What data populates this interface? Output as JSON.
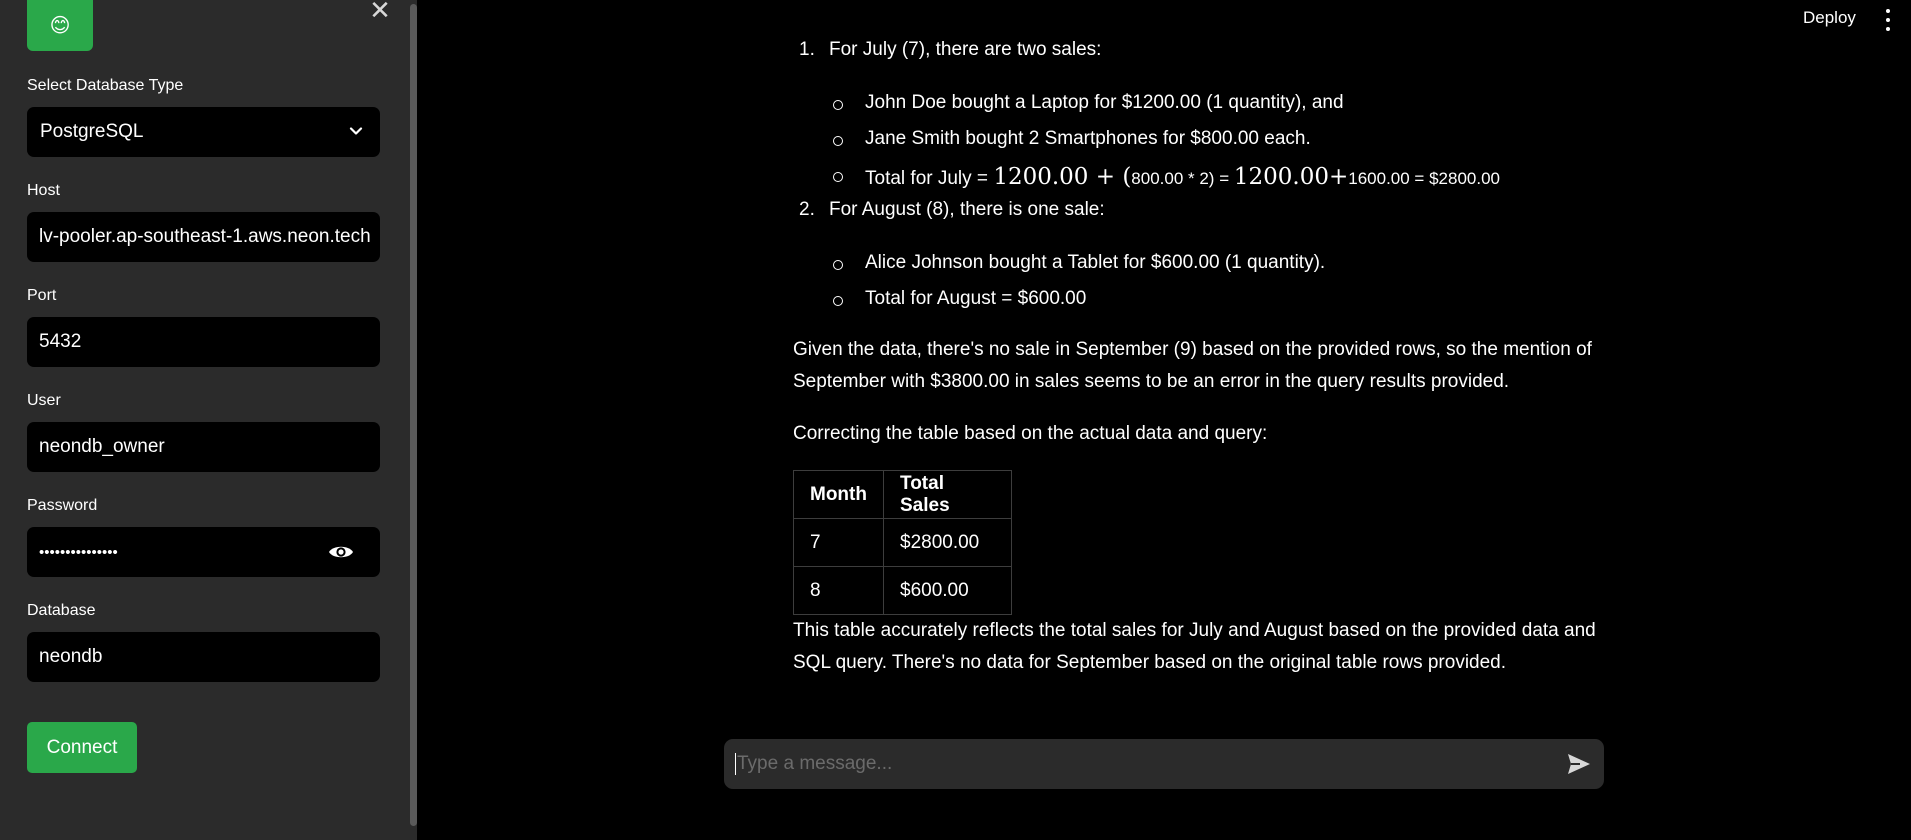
{
  "header": {
    "deploy_label": "Deploy"
  },
  "sidebar": {
    "logo_emoji": "😊",
    "db_type_label": "Select Database Type",
    "db_type_value": "PostgreSQL",
    "host_label": "Host",
    "host_value": "lv-pooler.ap-southeast-1.aws.neon.tech",
    "port_label": "Port",
    "port_value": "5432",
    "user_label": "User",
    "user_value": "neondb_owner",
    "password_label": "Password",
    "password_value": "•••••••••••••••",
    "database_label": "Database",
    "database_value": "neondb",
    "connect_label": "Connect"
  },
  "message": {
    "item1_num": "1.",
    "item1_text": "For July (7), there are two sales:",
    "item1_bullets": [
      "John Doe bought a Laptop for $1200.00 (1 quantity), and",
      "Jane Smith bought 2 Smartphones for $800.00 each."
    ],
    "total_july": {
      "prefix": "Total for July = ",
      "m1": "1200.00 + (",
      "s1": "800.00 * 2) = ",
      "m2": "1200.00+",
      "s2": "1600.00 = $2800.00"
    },
    "item2_num": "2.",
    "item2_text": "For August (8), there is one sale:",
    "item2_bullets": [
      "Alice Johnson bought a Tablet for $600.00 (1 quantity).",
      "Total for August = $600.00"
    ],
    "para1_line1": "Given the data, there's no sale in September (9) based on the provided rows, so the mention of",
    "para1_line2": "September with $3800.00 in sales seems to be an error in the query results provided.",
    "para2": "Correcting the table based on the actual data and query:",
    "table": {
      "headers": [
        "Month",
        "Total Sales"
      ],
      "rows": [
        [
          "7",
          "$2800.00"
        ],
        [
          "8",
          "$600.00"
        ]
      ]
    },
    "para3_line1": "This table accurately reflects the total sales for July and August based on the provided data and",
    "para3_line2": "SQL query. There's no data for September based on the original table rows provided."
  },
  "chat": {
    "placeholder": "Type a message..."
  },
  "colors": {
    "accent_green": "#2aa84a",
    "sidebar_bg": "#2b2b2b",
    "main_bg": "#000000"
  }
}
